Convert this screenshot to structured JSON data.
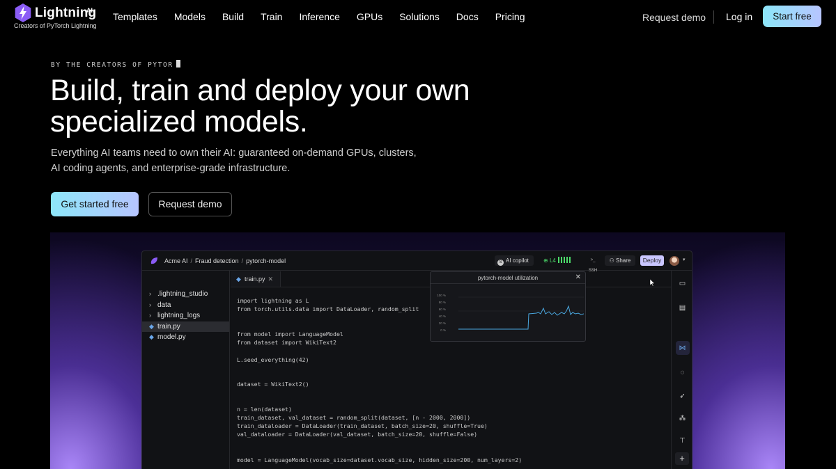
{
  "brand": {
    "name": "Lightning",
    "suffix": "AI",
    "tagline": "Creators of PyTorch Lightning"
  },
  "nav": {
    "links": [
      "Templates",
      "Models",
      "Build",
      "Train",
      "Inference",
      "GPUs",
      "Solutions",
      "Docs",
      "Pricing"
    ],
    "request_demo": "Request demo",
    "login": "Log in",
    "start_free": "Start free"
  },
  "hero": {
    "eyebrow": "BY THE CREATORS OF PYTOR",
    "headline_line1": "Build, train and deploy your own",
    "headline_line2": "specialized models.",
    "subline_line1": "Everything AI teams need to own their AI: guaranteed on-demand GPUs, clusters,",
    "subline_line2": "AI coding agents, and enterprise-grade infrastructure.",
    "cta_primary": "Get started free",
    "cta_secondary": "Request demo"
  },
  "ide": {
    "breadcrumb": [
      "Acme AI",
      "Fraud detection",
      "pytorch-model"
    ],
    "copilot_label": "AI copilot",
    "status_label": "L4",
    "ssh_label": "SSH",
    "share_label": "Share",
    "deploy_label": "Deploy",
    "tree": [
      {
        "label": ".lightning_studio",
        "kind": "folder"
      },
      {
        "label": "data",
        "kind": "folder"
      },
      {
        "label": "lightning_logs",
        "kind": "folder"
      },
      {
        "label": "train.py",
        "kind": "python",
        "selected": true
      },
      {
        "label": "model.py",
        "kind": "python"
      }
    ],
    "tab_label": "train.py",
    "utilization": {
      "title": "pytorch-model utilization",
      "ticks": [
        "100 %",
        "80 %",
        "60 %",
        "40 %",
        "20 %",
        "0 %"
      ]
    },
    "code": {
      "l1": "import lightning as L",
      "l2": "from torch.utils.data import DataLoader, random_split",
      "l3": "from model import LanguageModel",
      "l4": "from dataset import WikiText2",
      "l5": "L.seed_everything(42)",
      "l6": "dataset = WikiText2()",
      "l7": "n = len(dataset)",
      "l8": "train_dataset, val_dataset = random_split(dataset, [n - 2000, 2000])",
      "l9": "train_dataloader = DataLoader(train_dataset, batch_size=20, shuffle=True)",
      "l10": "val_dataloader = DataLoader(val_dataset, batch_size=20, shuffle=False)",
      "l11": "model = LanguageModel(vocab_size=dataset.vocab_size, hidden_size=200, num_layers=2)"
    }
  },
  "colors": {
    "accent_gradient_start": "#8de6f9",
    "accent_gradient_end": "#b7c5ff",
    "deploy_bg": "#c9c6ff",
    "status_green": "#4cdc6a",
    "showcase_purple": "#7a4cf0"
  }
}
